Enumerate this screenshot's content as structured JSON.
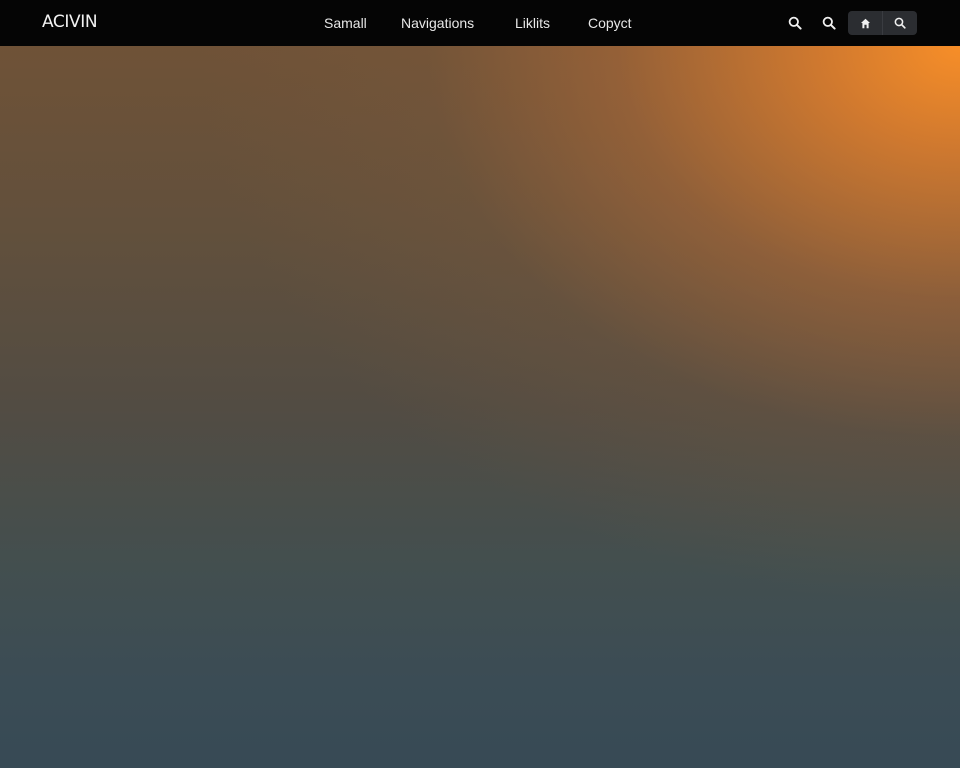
{
  "header": {
    "brand": "ACIVIN",
    "nav": [
      {
        "label": "Samall"
      },
      {
        "label": "Navigations"
      },
      {
        "label": "Liklits"
      },
      {
        "label": "Copyct"
      }
    ],
    "icons": [
      "search-icon",
      "search-icon",
      "home-icon",
      "search-icon"
    ]
  },
  "colors": {
    "navbar_bg": "#050505",
    "pill_bg": "#2b2d31",
    "accent_orange": "#f78e28",
    "bottom_teal": "#374a55"
  }
}
